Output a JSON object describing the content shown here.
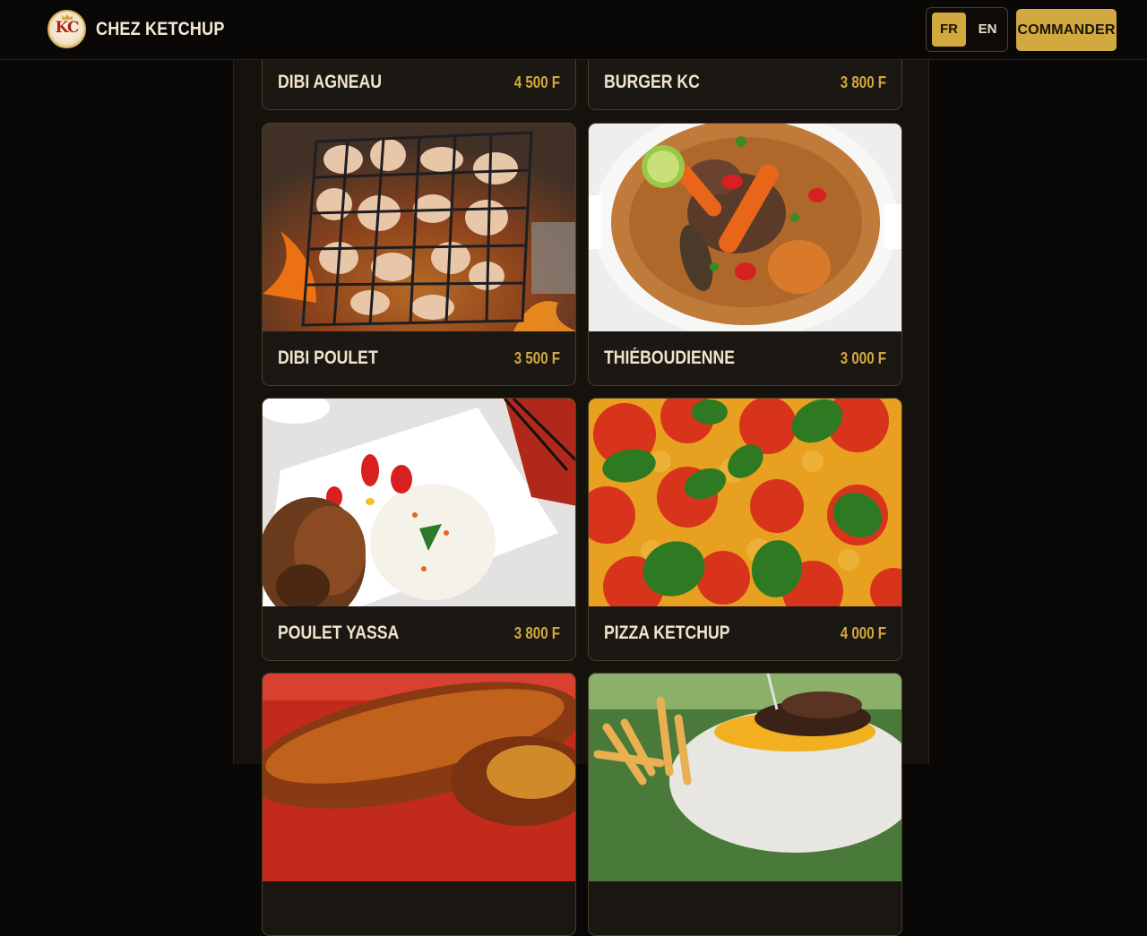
{
  "header": {
    "brand_name": "CHEZ KETCHUP",
    "logo_text": "KC",
    "logo_subtext": "CHEZ KETCHUP",
    "lang_fr": "FR",
    "lang_en": "EN",
    "cta_label": "COMMANDER"
  },
  "colors": {
    "accent": "#d2a93e",
    "background": "#0a0807",
    "panel": "#15110d",
    "text": "#f0e4cc"
  },
  "menu": [
    {
      "name": "DIBI AGNEAU",
      "price": "4 500 F"
    },
    {
      "name": "BURGER KC",
      "price": "3 800 F"
    },
    {
      "name": "DIBI POULET",
      "price": "3 500 F"
    },
    {
      "name": "THIÉBOUDIENNE",
      "price": "3 000 F"
    },
    {
      "name": "POULET YASSA",
      "price": "3 800 F"
    },
    {
      "name": "PIZZA KETCHUP",
      "price": "4 000 F"
    }
  ]
}
